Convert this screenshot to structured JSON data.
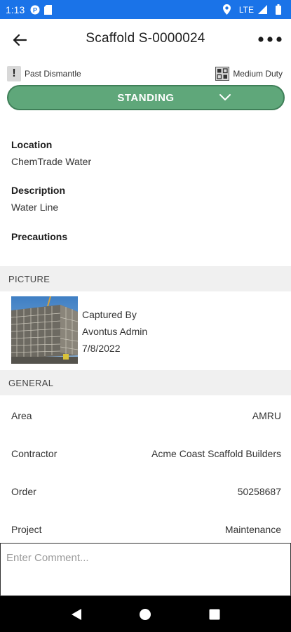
{
  "status_bar": {
    "time": "1:13",
    "network": "LTE"
  },
  "app_bar": {
    "title": "Scaffold S-0000024"
  },
  "tags": {
    "left": "Past Dismantle",
    "right": "Medium Duty"
  },
  "status_button": {
    "label": "STANDING",
    "color": "#5fa77a"
  },
  "details": {
    "location_label": "Location",
    "location_value": "ChemTrade Water",
    "description_label": "Description",
    "description_value": "Water Line",
    "precautions_label": "Precautions"
  },
  "picture_section": {
    "header": "PICTURE",
    "captured_by_label": "Captured By",
    "captured_by": "Avontus Admin",
    "date": "7/8/2022"
  },
  "general_section": {
    "header": "GENERAL",
    "rows": [
      {
        "label": "Area",
        "value": "AMRU"
      },
      {
        "label": "Contractor",
        "value": "Acme Coast Scaffold Builders"
      },
      {
        "label": "Order",
        "value": "50258687"
      },
      {
        "label": "Project",
        "value": "Maintenance"
      }
    ]
  },
  "comment": {
    "placeholder": "Enter Comment..."
  }
}
